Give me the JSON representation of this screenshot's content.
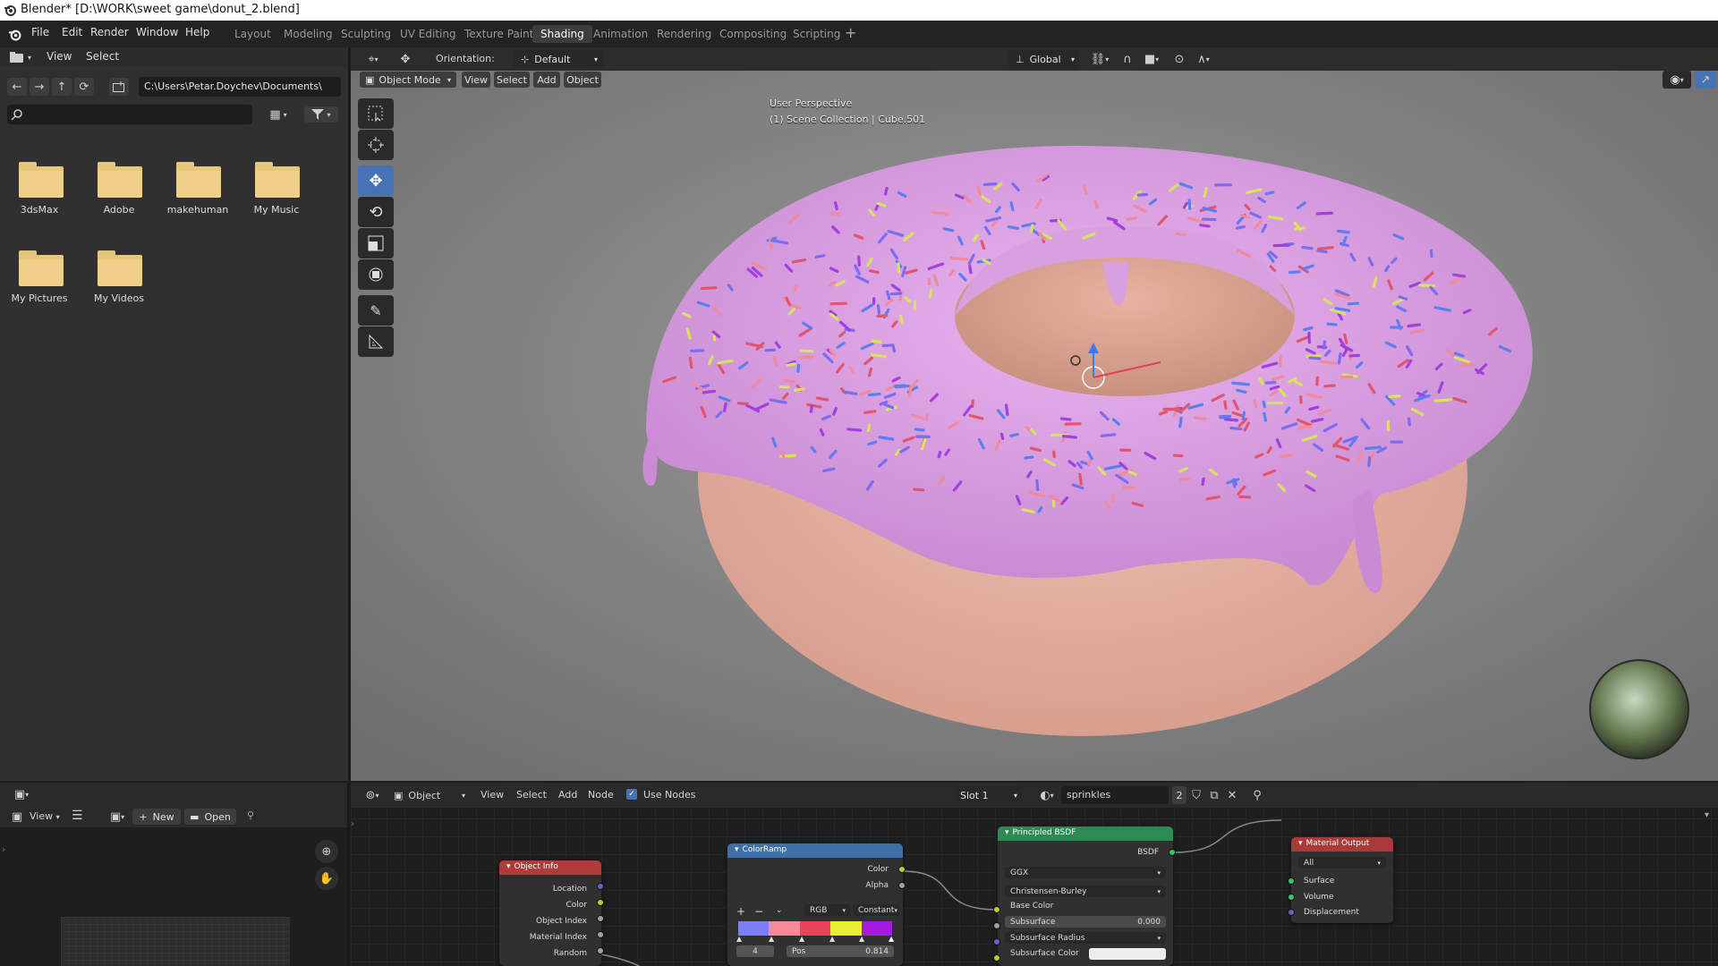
{
  "titlebar": {
    "title": "Blender* [D:\\WORK\\sweet game\\donut_2.blend]"
  },
  "menu": {
    "items": [
      "File",
      "Edit",
      "Render",
      "Window",
      "Help"
    ]
  },
  "workspaces": {
    "tabs": [
      "Layout",
      "Modeling",
      "Sculpting",
      "UV Editing",
      "Texture Paint",
      "Shading",
      "Animation",
      "Rendering",
      "Compositing",
      "Scripting"
    ],
    "active": "Shading",
    "add_icon": "plus-icon"
  },
  "file_browser": {
    "header": {
      "view_label": "View",
      "select_label": "Select"
    },
    "path": "C:\\Users\\Petar.Doychev\\Documents\\",
    "search_placeholder": "",
    "folders": [
      "3dsMax",
      "Adobe",
      "makehuman",
      "My Music",
      "My Pictures",
      "My Videos"
    ],
    "folder_color": "#e8c77a"
  },
  "viewport_header": {
    "orientation_label": "Orientation:",
    "orientation_value": "Default",
    "transform_space": "Global",
    "mode": "Object Mode",
    "view_label": "View",
    "select_label": "Select",
    "add_label": "Add",
    "object_label": "Object"
  },
  "viewport": {
    "perspective_text": "User Perspective",
    "collection_text": "(1) Scene Collection | Cube.501",
    "icing_color": "#d99be0",
    "dough_color": "#e7b3a3",
    "sprinkle_colors": [
      "#7b6cf0",
      "#e0566c",
      "#d8e25c",
      "#a13fe0",
      "#5c7ff0",
      "#f08a9d"
    ]
  },
  "image_editor": {
    "view_label": "View",
    "new_label": "New",
    "open_label": "Open"
  },
  "node_editor": {
    "header": {
      "type": "Object",
      "view_label": "View",
      "select_label": "Select",
      "add_label": "Add",
      "node_label": "Node",
      "use_nodes_label": "Use Nodes",
      "use_nodes_checked": true,
      "slot": "Slot 1",
      "material": "sprinkles",
      "users": "2"
    },
    "object_info": {
      "title": "Object Info",
      "header_color": "#b23a3a",
      "outputs": [
        "Location",
        "Color",
        "Object Index",
        "Material Index",
        "Random"
      ]
    },
    "color_ramp": {
      "title": "ColorRamp",
      "header_color": "#3d6fa8",
      "outputs": [
        "Color",
        "Alpha"
      ],
      "color_mode": "RGB",
      "interpolation": "Constant",
      "stops": [
        "#7e7ef5",
        "#f58a9a",
        "#e8455b",
        "#eaf02f",
        "#a21ce0"
      ],
      "stop_index": "4",
      "pos_label": "Pos",
      "pos_value": "0.814"
    },
    "principled": {
      "title": "Principled BSDF",
      "header_color": "#2d8a52",
      "output": "BSDF",
      "distribution": "GGX",
      "subsurface_method": "Christensen-Burley",
      "inputs": [
        "Base Color",
        "Subsurface",
        "Subsurface Radius",
        "Subsurface Color"
      ],
      "subsurface_value": "0.000"
    },
    "material_output": {
      "title": "Material Output",
      "header_color": "#a83a3a",
      "target": "All",
      "inputs": [
        "Surface",
        "Volume",
        "Displacement"
      ]
    }
  }
}
